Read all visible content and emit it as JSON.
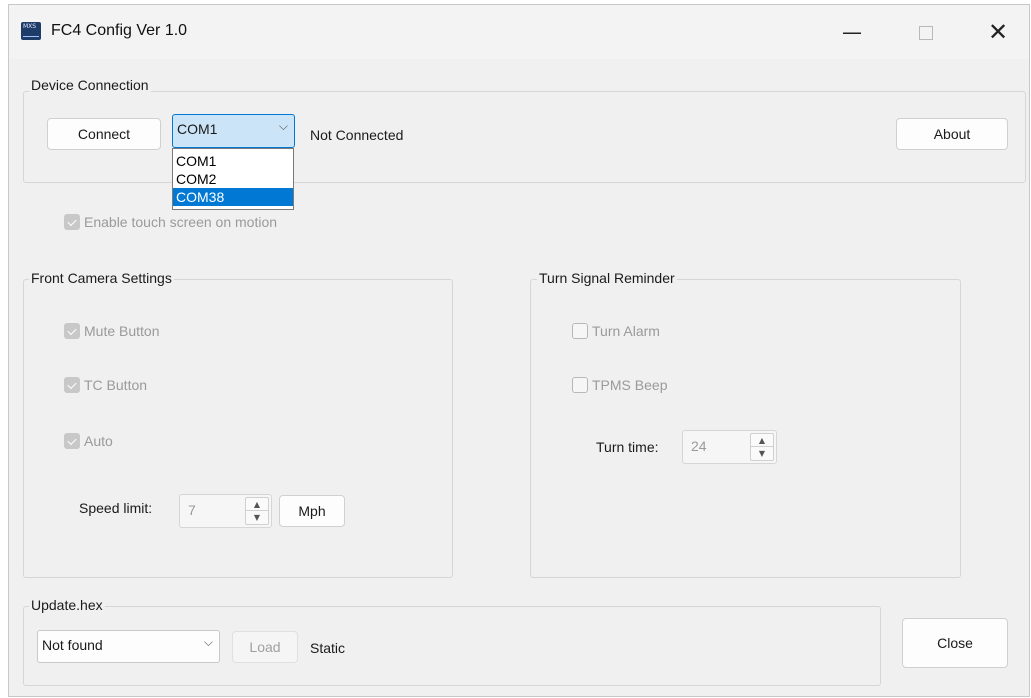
{
  "window": {
    "title": "FC4 Config Ver 1.0",
    "icon_text": "MXS",
    "controls": {
      "minimize": "—",
      "close": "✕"
    }
  },
  "device_connection": {
    "title": "Device Connection",
    "connect_label": "Connect",
    "port_selected": "COM1",
    "port_options": [
      "COM1",
      "COM2",
      "COM38"
    ],
    "highlighted_option": "COM38",
    "status": "Not Connected",
    "about_label": "About"
  },
  "enable_touch": {
    "label": "Enable touch screen on motion",
    "checked": true,
    "enabled": false
  },
  "front_camera": {
    "title": "Front Camera Settings",
    "mute_label": "Mute Button",
    "tc_label": "TC Button",
    "auto_label": "Auto",
    "speed_label": "Speed limit:",
    "speed_value": "7",
    "unit_label": "Mph"
  },
  "turn_signal": {
    "title": "Turn Signal Reminder",
    "turn_alarm_label": "Turn Alarm",
    "tpms_label": "TPMS Beep",
    "turn_time_label": "Turn time:",
    "turn_time_value": "24"
  },
  "update": {
    "title": "Update.hex",
    "file_selected": "Not found",
    "load_label": "Load",
    "status": "Static"
  },
  "close_label": "Close",
  "icons": {
    "chevron": "chevron-down-icon",
    "spin_up": "arrow-up-icon",
    "spin_down": "arrow-down-icon"
  }
}
